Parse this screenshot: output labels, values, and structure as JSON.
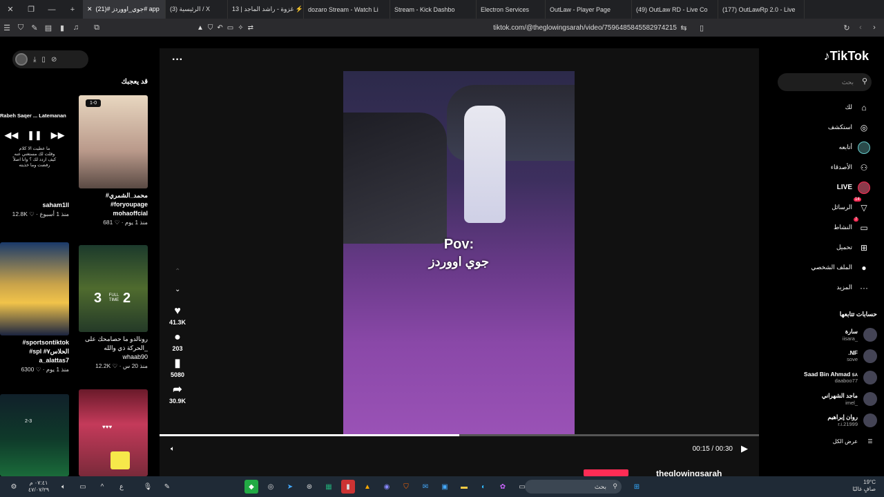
{
  "browser": {
    "tabs": [
      {
        "label": "(21)# جوي_اووردز# app",
        "color": "#25f4ee",
        "active": true
      },
      {
        "label": "(3) الرئيسية / X",
        "color": "#ffffff"
      },
      {
        "label": "13 | غزوة - راشد الماجد ⚡",
        "color": "#ff0000"
      },
      {
        "label": "dozaro Stream - Watch Li",
        "color": "#53fc18"
      },
      {
        "label": "Stream - Kick Dashbo",
        "color": "#53fc18"
      },
      {
        "label": "Electron Services",
        "color": "#53fc18"
      },
      {
        "label": "OutLaw - Player Page",
        "color": "#5865f2"
      },
      {
        "label": "(49) OutLaw RD - Live Co",
        "color": "#53fc18"
      },
      {
        "label": "(177) OutLawRp 2.0 - Live",
        "color": "#53fc18"
      }
    ],
    "url": "tiktok.com/@theglowingsarah/video/7596485845582974215"
  },
  "left": {
    "section_title": "قد يعجبك",
    "mini_player": {
      "track": "Rabeh Saqer ... Latemanan",
      "lyrics": "ما عطيت الا كلام\nوقلت لك مستغني عنه\nكيف اردد لك ؟ وانا اصلاً\nرفضت وما خذيته"
    },
    "cards": [
      {
        "id": "c1",
        "caption": "",
        "author": "saham1ll",
        "likes": "12.8K",
        "time": "منذ 1 أسبوع"
      },
      {
        "id": "c2",
        "caption": "#محمد_الشمري\n#foryoupage",
        "author": "mohaoffcial",
        "likes": "681",
        "time": "منذ 1 يوم",
        "score": "1-0"
      },
      {
        "id": "c3",
        "caption": "#sportsontiktok\n#spl #الحلاس٧",
        "author": "a_alattas7",
        "likes": "6300",
        "time": "منذ 1 يوم"
      },
      {
        "id": "c4",
        "caption": "رونالدو ما حصامحك على\nالحركة ذي والله_",
        "author": "whaab90",
        "likes": "12.2K",
        "time": "منذ 20 س",
        "score_left": "3",
        "score_right": "2",
        "score_label": "FULL TIME"
      },
      {
        "id": "c5",
        "caption": "",
        "author": "",
        "likes": "",
        "time": "",
        "score": "2-3"
      },
      {
        "id": "c6",
        "caption": "",
        "author": "",
        "likes": "",
        "time": "",
        "badge": "♥♥♥"
      }
    ]
  },
  "video": {
    "overlay_line1": "Pov:",
    "overlay_line2": "جوي اووردز",
    "likes": "41.3K",
    "comments": "203",
    "saves": "5080",
    "shares": "30.9K",
    "time": "00:15 / 00:30",
    "progress": 0.5,
    "author": "theglowingsarah"
  },
  "right": {
    "logo": "TikTok",
    "search_placeholder": "بحث",
    "nav": [
      {
        "label": "لك",
        "icon": "home"
      },
      {
        "label": "استكشف",
        "icon": "compass"
      },
      {
        "label": "أتابعه",
        "icon": "avatar"
      },
      {
        "label": "الأصدقاء",
        "icon": "friends"
      },
      {
        "label": "LIVE",
        "icon": "live"
      },
      {
        "label": "الرسائل",
        "icon": "messages",
        "badge": "14"
      },
      {
        "label": "النشاط",
        "icon": "activity",
        "badge": "7"
      },
      {
        "label": "تحميل",
        "icon": "upload"
      },
      {
        "label": "الملف الشخصي",
        "icon": "profile"
      },
      {
        "label": "المزيد",
        "icon": "more"
      }
    ],
    "following_title": "حسابات تتابعها",
    "accounts": [
      {
        "name": "سارة",
        "handle": "iisara_"
      },
      {
        "name": ".NF",
        "handle": "sove"
      },
      {
        "name": "Saad Bin Ahmad",
        "handle": "daaboo77",
        "tag": "SA"
      },
      {
        "name": "ماجد الشهراني",
        "handle": "imel_"
      },
      {
        "name": "روان إبراهيم",
        "handle": "r.i.21999"
      }
    ],
    "show_all": "عرض الكل"
  },
  "taskbar": {
    "time": "٠٧:٤١ م",
    "date": "٤٧/٠٧/٢٩",
    "search": "بحث",
    "weather_temp": "19°C",
    "weather_desc": "صافٍ غالبًا",
    "lang": "ع"
  }
}
